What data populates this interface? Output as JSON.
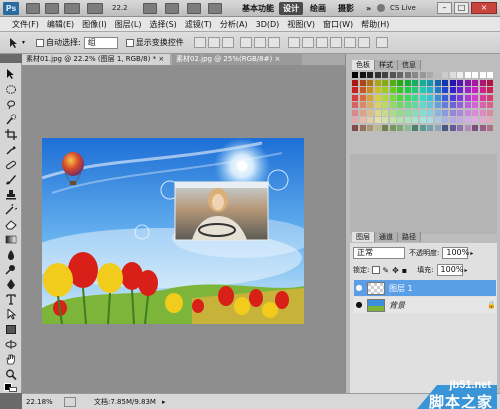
{
  "titlebar": {
    "logo": "Ps",
    "zoom": "22.2",
    "workspaces": [
      "基本功能",
      "设计",
      "绘画",
      "摄影"
    ],
    "more": "»",
    "cs_live": "CS Live",
    "window_min": "–",
    "window_max": "□",
    "window_close": "×"
  },
  "menu": [
    "文件(F)",
    "编辑(E)",
    "图像(I)",
    "图层(L)",
    "选择(S)",
    "滤镜(T)",
    "分析(A)",
    "3D(D)",
    "视图(V)",
    "窗口(W)",
    "帮助(H)"
  ],
  "options": {
    "auto_select_label": "自动选择:",
    "auto_select_value": "组",
    "transform_label": "显示变换控件"
  },
  "tabs": [
    {
      "label": "素材01.jpg @ 22.2% (图层 1, RGB/8) *",
      "close": "×"
    },
    {
      "label": "素材02.jpg @ 25%(RGB/8#)",
      "close": "×"
    }
  ],
  "status": {
    "zoom": "22.18%",
    "doc": "文档:7.85M/9.83M"
  },
  "panels": {
    "top_tabs": [
      "色板",
      "样式",
      "信息"
    ],
    "layer_tabs": [
      "图层",
      "通道",
      "路径"
    ],
    "blend_mode": "正常",
    "opacity_label": "不透明度:",
    "opacity": "100%",
    "lock_label": "锁定:",
    "fill_label": "填充:",
    "fill": "100%",
    "layers": [
      {
        "name": "图层 1",
        "selected": true
      },
      {
        "name": "背景",
        "selected": false
      }
    ]
  },
  "watermark": {
    "site": "jb51.net",
    "text": "脚本之家"
  },
  "colors": {
    "accent": "#3b8edb",
    "selected_layer": "#5a9ee6"
  }
}
